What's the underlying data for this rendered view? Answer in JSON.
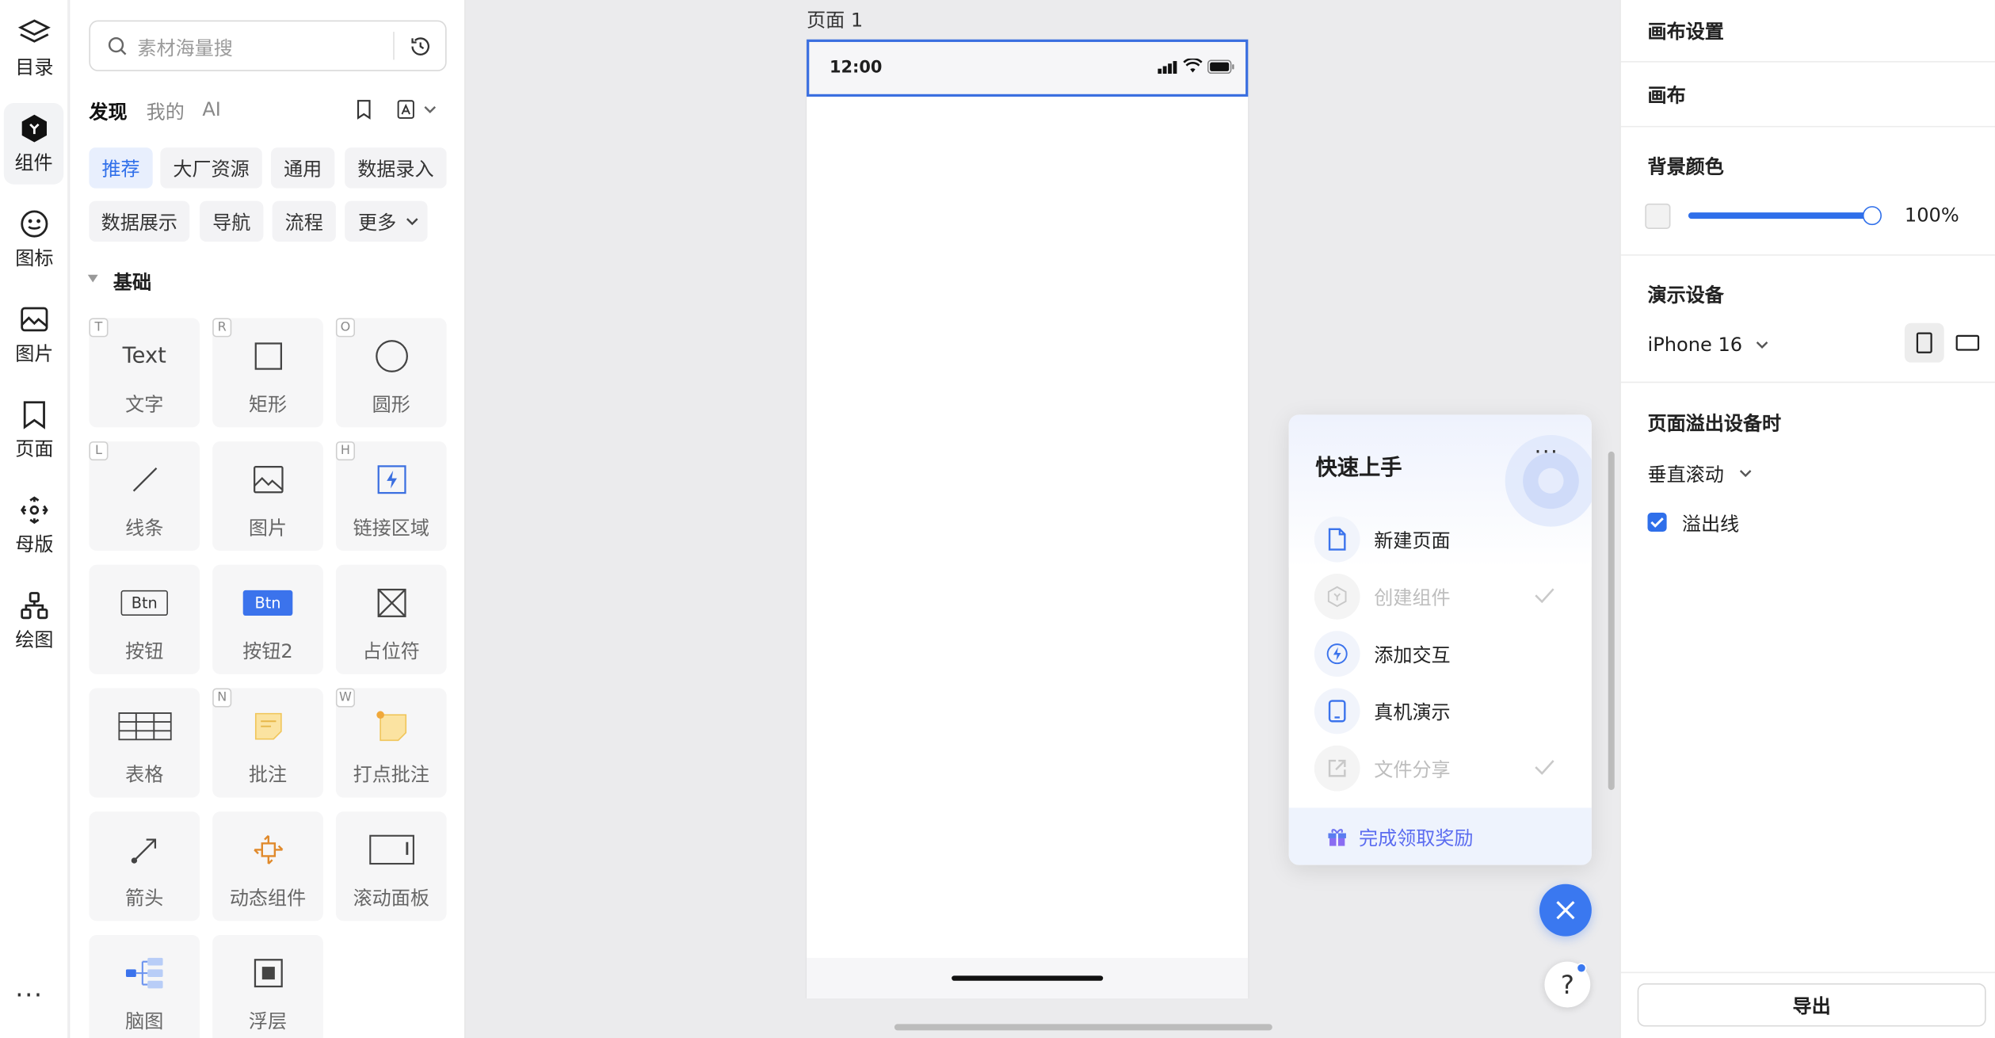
{
  "rail": {
    "items": [
      {
        "label": "目录",
        "icon": "layers-icon"
      },
      {
        "label": "组件",
        "icon": "component-icon"
      },
      {
        "label": "图标",
        "icon": "smiley-icon"
      },
      {
        "label": "图片",
        "icon": "image-icon"
      },
      {
        "label": "页面",
        "icon": "page-icon"
      },
      {
        "label": "母版",
        "icon": "master-icon"
      },
      {
        "label": "绘图",
        "icon": "drawing-icon"
      }
    ],
    "more": "···"
  },
  "panel": {
    "search_placeholder": "素材海量搜",
    "tabs": [
      "发现",
      "我的",
      "AI"
    ],
    "chips": [
      "推荐",
      "大厂资源",
      "通用",
      "数据录入",
      "数据展示",
      "导航",
      "流程",
      "更多"
    ],
    "section": "基础",
    "tiles": [
      {
        "label": "文字",
        "key": "T",
        "icon_text": "Text"
      },
      {
        "label": "矩形",
        "key": "R"
      },
      {
        "label": "圆形",
        "key": "O"
      },
      {
        "label": "线条",
        "key": "L"
      },
      {
        "label": "图片",
        "key": ""
      },
      {
        "label": "链接区域",
        "key": "H"
      },
      {
        "label": "按钮",
        "key": "",
        "icon_text": "Btn"
      },
      {
        "label": "按钮2",
        "key": "",
        "icon_text": "Btn"
      },
      {
        "label": "占位符",
        "key": ""
      },
      {
        "label": "表格",
        "key": ""
      },
      {
        "label": "批注",
        "key": "N"
      },
      {
        "label": "打点批注",
        "key": "W"
      },
      {
        "label": "箭头",
        "key": ""
      },
      {
        "label": "动态组件",
        "key": ""
      },
      {
        "label": "滚动面板",
        "key": ""
      },
      {
        "label": "脑图",
        "key": ""
      },
      {
        "label": "浮层",
        "key": ""
      }
    ]
  },
  "canvas": {
    "page_label": "页面 1",
    "time": "12:00"
  },
  "quickstart": {
    "title": "快速上手",
    "items": [
      {
        "label": "新建页面",
        "done": false,
        "icon": "file-icon"
      },
      {
        "label": "创建组件",
        "done": true,
        "icon": "component-icon"
      },
      {
        "label": "添加交互",
        "done": false,
        "icon": "lightning-icon"
      },
      {
        "label": "真机演示",
        "done": false,
        "icon": "phone-icon"
      },
      {
        "label": "文件分享",
        "done": true,
        "icon": "share-icon"
      }
    ],
    "reward": "完成领取奖励",
    "help": "?"
  },
  "right": {
    "title": "画布设置",
    "canvas_label": "画布",
    "bg_label": "背景颜色",
    "opacity": "100%",
    "device_label": "演示设备",
    "device": "iPhone 16",
    "overflow_label": "页面溢出设备时",
    "overflow_mode": "垂直滚动",
    "overflow_line": "溢出线",
    "export": "导出"
  },
  "colors": {
    "accent": "#2f6fea",
    "reward": "#7a5cf0"
  }
}
